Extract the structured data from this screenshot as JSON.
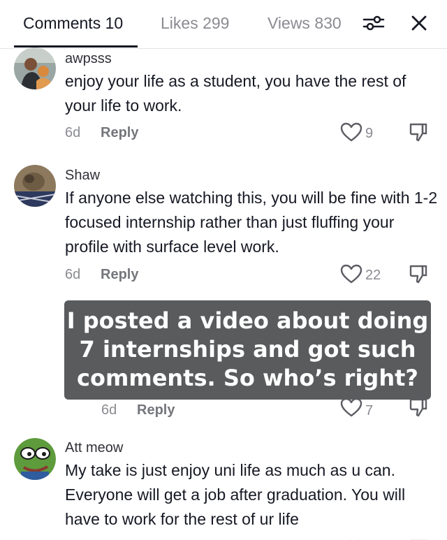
{
  "tabs": {
    "comments": "Comments 10",
    "likes": "Likes 299",
    "views": "Views 830"
  },
  "icons": {
    "filter": "filter-sliders-icon",
    "close": "close-x-icon",
    "like": "heart-outline-icon",
    "dislike": "thumbs-down-outline-icon"
  },
  "comments": [
    {
      "username": "awpsss",
      "text": "enjoy your life as a student, you have the rest of your life to work.",
      "time": "6d",
      "reply": "Reply",
      "likes": "9"
    },
    {
      "username": "Shaw",
      "text": "If anyone else watching this, you will be fine with 1-2 focused internship rather than just fluffing your profile with surface level work.",
      "time": "6d",
      "reply": "Reply",
      "likes": "22"
    },
    {
      "username": "",
      "text": "",
      "time": "6d",
      "reply": "Reply",
      "likes": "7"
    },
    {
      "username": "Att meow",
      "text": "My take is just enjoy uni life as much as u can. Everyone will get a job after graduation. You will have to work for the rest of ur life",
      "time": "",
      "reply": "",
      "likes": ""
    }
  ],
  "overlay": {
    "line1": "I posted a video about doing",
    "line2": "7 internships and got such",
    "line3": "comments. So who’s right?"
  },
  "colors": {
    "text_primary": "#161823",
    "text_secondary": "#8a8b91",
    "overlay_bg": "#595b5d",
    "divider": "#e3e3e4"
  }
}
